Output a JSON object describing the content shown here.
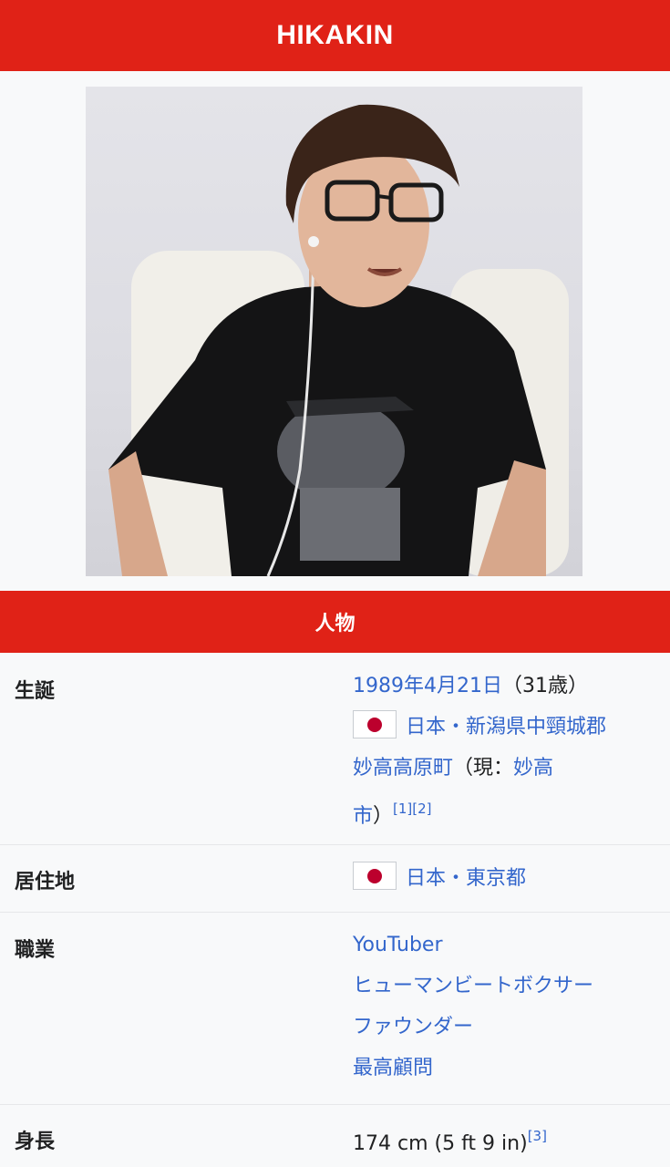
{
  "title": "HIKAKIN",
  "photo_alt": "HIKAKIN portrait",
  "section_header": "人物",
  "rows": {
    "birth": {
      "label": "生誕",
      "date_link": "1989年4月21日",
      "age": "（31歳）",
      "place_link_1": "日本・新潟県中頸城郡",
      "place_link_2": "妙高高原町",
      "now_prefix": "（現：",
      "now_link_a": "妙高",
      "now_link_b": "市",
      "now_suffix": "）",
      "refs": "[1][2]"
    },
    "residence": {
      "label": "居住地",
      "value_link": "日本・東京都"
    },
    "occupation": {
      "label": "職業",
      "items": [
        "YouTuber",
        "ヒューマンビートボクサー",
        "ファウンダー",
        "最高顧問"
      ]
    },
    "height": {
      "label": "身長",
      "value": "174 cm (5 ft 9 in)",
      "ref": "[3]"
    }
  },
  "colors": {
    "header_red": "#e02217",
    "link_blue": "#3366cc",
    "flag_red": "#bc002d",
    "background": "#f8f9fa"
  },
  "icons": {
    "flag": "japan-flag-icon"
  }
}
